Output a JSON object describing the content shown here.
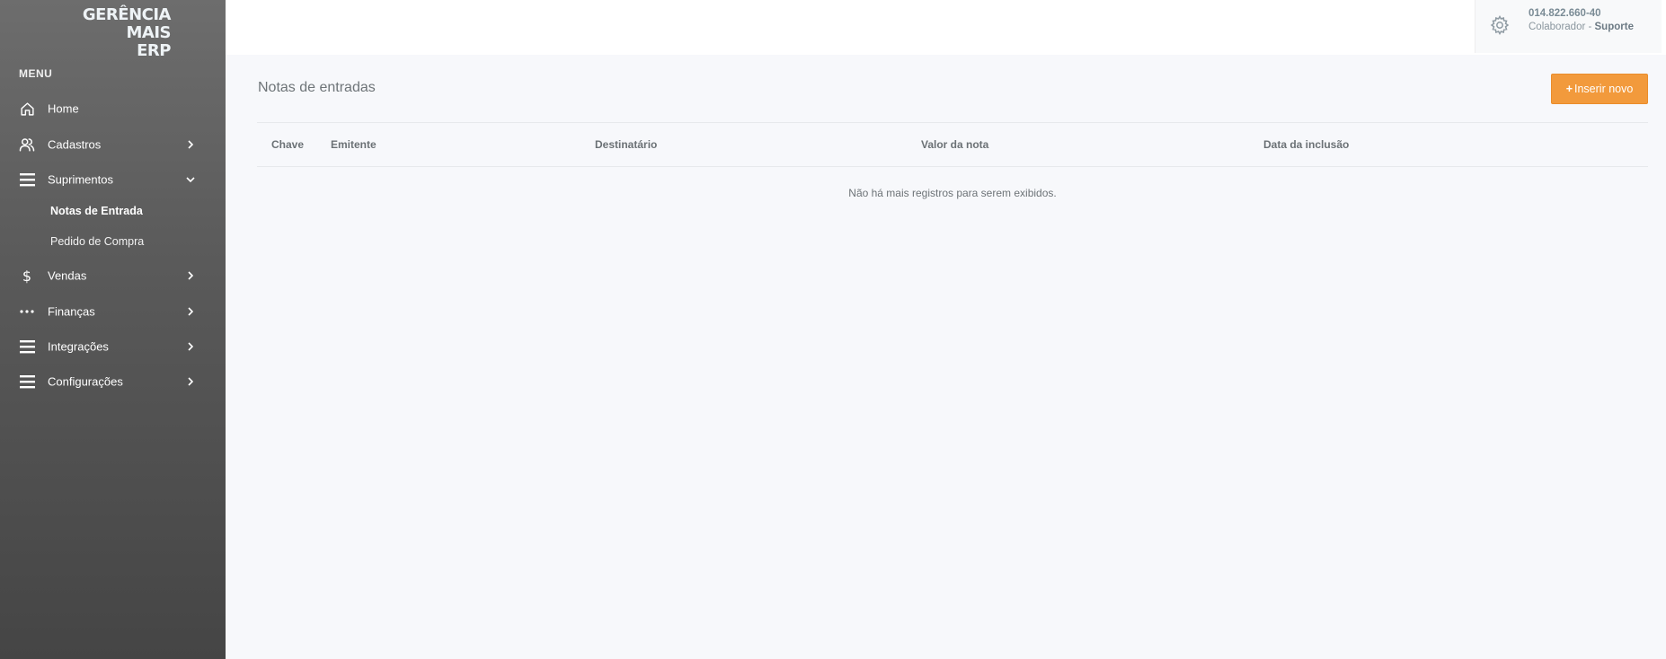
{
  "brand": {
    "line1": "GERÊNCIA MAIS",
    "line2": "ERP"
  },
  "sidebar": {
    "menu_heading": "MENU",
    "items": [
      {
        "label": "Home",
        "icon": "home-icon"
      },
      {
        "label": "Cadastros",
        "icon": "users-icon",
        "chevron": "chevron-right-icon"
      },
      {
        "label": "Suprimentos",
        "icon": "menu-lines-icon",
        "chevron": "chevron-down-icon",
        "subitems": [
          {
            "label": "Notas de Entrada",
            "active": true
          },
          {
            "label": "Pedido de Compra",
            "active": false
          }
        ]
      },
      {
        "label": "Vendas",
        "icon": "dollar-icon",
        "chevron": "chevron-right-icon"
      },
      {
        "label": "Finanças",
        "icon": "dots-icon",
        "chevron": "chevron-right-icon"
      },
      {
        "label": "Integrações",
        "icon": "menu-lines-icon",
        "chevron": "chevron-right-icon"
      },
      {
        "label": "Configurações",
        "icon": "menu-lines-icon",
        "chevron": "chevron-right-icon"
      }
    ]
  },
  "user": {
    "id": "014.822.660-40",
    "role_prefix": "Colaborador - ",
    "role_name": "Suporte",
    "icon": "gear-icon"
  },
  "main": {
    "title": "Notas de entradas",
    "insert_button": {
      "plus": "+",
      "label": "Inserir novo"
    },
    "table": {
      "columns": [
        "Chave",
        "Emitente",
        "Destinatário",
        "Valor da nota",
        "Data da inclusão"
      ],
      "empty_message": "Não há mais registros para serem exibidos."
    }
  },
  "colors": {
    "sidebar_top": "#6d6d6d",
    "sidebar_bottom": "#454545",
    "accent": "#f29a3c",
    "background": "#f7f8fb"
  }
}
